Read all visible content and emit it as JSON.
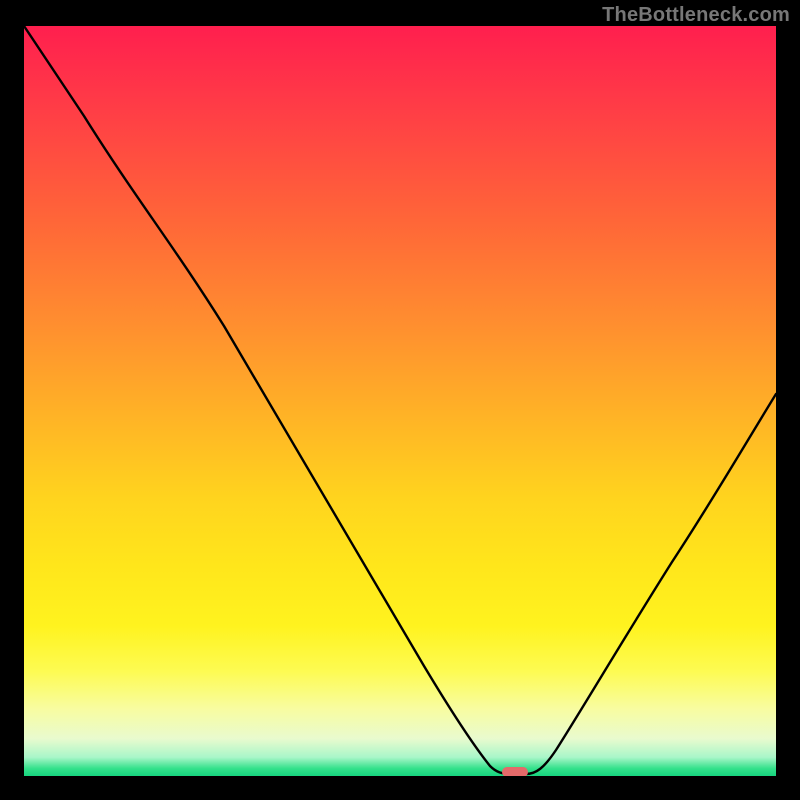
{
  "watermark": "TheBottleneck.com",
  "colors": {
    "frame_bg": "#000000",
    "gradient_top": "#ff1f4e",
    "gradient_mid": "#ffd41e",
    "gradient_bottom": "#17d47f",
    "curve_stroke": "#000000",
    "marker_fill": "#e46a6a"
  },
  "chart_data": {
    "type": "line",
    "title": "",
    "xlabel": "",
    "ylabel": "",
    "xlim": [
      0,
      100
    ],
    "ylim": [
      0,
      100
    ],
    "grid": false,
    "series": [
      {
        "name": "bottleneck-curve",
        "x": [
          0,
          8,
          18,
          26,
          34,
          42,
          50,
          56,
          60,
          62,
          64,
          66,
          70,
          78,
          88,
          100
        ],
        "y": [
          100,
          88,
          74,
          66,
          56,
          44,
          32,
          20,
          8,
          1,
          0,
          0,
          6,
          20,
          36,
          56
        ]
      }
    ],
    "annotations": [
      {
        "name": "min-marker",
        "shape": "rounded-rect",
        "x": 65,
        "y": 0,
        "width_pct": 3.2,
        "height_pct": 1.2
      }
    ],
    "notes": "V-shaped curve reaching a minimum of ~0 around x≈64–66; left branch starts at top-left corner (100), right branch rises to ~56 at x=100. Gradient background encodes value: red=high bottleneck, green=low."
  }
}
